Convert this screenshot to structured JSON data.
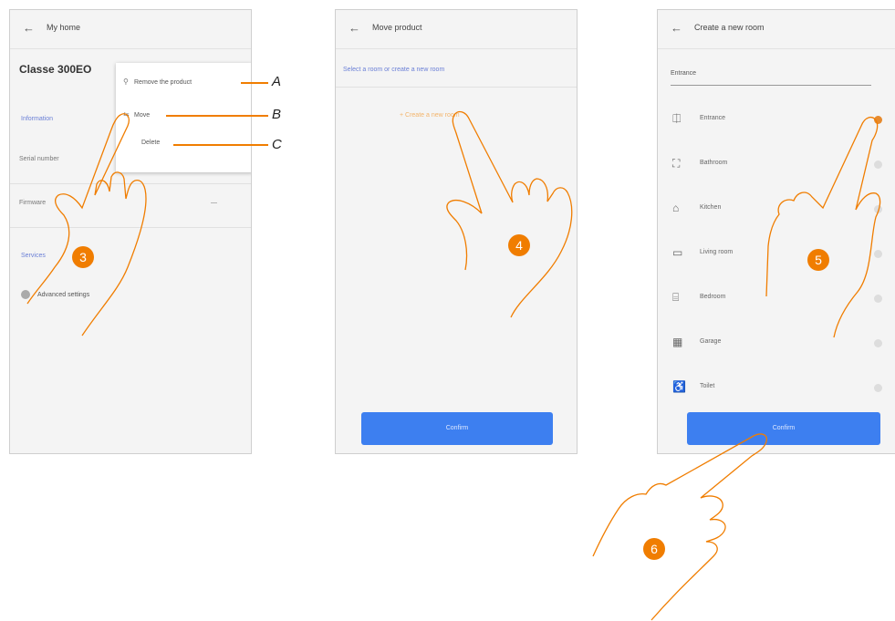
{
  "panel1": {
    "title": "My home",
    "device_title": "Classe 300EO",
    "menu": {
      "remove": "Remove the product",
      "move": "Move",
      "delete": "Delete"
    },
    "blue_label": "Information",
    "serial_label": "Serial number",
    "firmware_label": "Firmware",
    "firmware_value": "—",
    "section_link": "Services",
    "advanced": "Advanced settings"
  },
  "panel2": {
    "title": "Move product",
    "blue_info": "Select a room or create a new room",
    "orange_option": "+ Create a new room",
    "confirm": "Confirm"
  },
  "panel3": {
    "title": "Create a new room",
    "input_value": "Entrance",
    "rooms": [
      {
        "icon": "entrance-icon",
        "glyph": "⎅",
        "label": "Entrance",
        "selected": true
      },
      {
        "icon": "bathroom-icon",
        "glyph": "⛶",
        "label": "Bathroom",
        "selected": false
      },
      {
        "icon": "kitchen-icon",
        "glyph": "⌂",
        "label": "Kitchen",
        "selected": false
      },
      {
        "icon": "living-room-icon",
        "glyph": "▭",
        "label": "Living room",
        "selected": false
      },
      {
        "icon": "bedroom-icon",
        "glyph": "⌸",
        "label": "Bedroom",
        "selected": false
      },
      {
        "icon": "garage-icon",
        "glyph": "▦",
        "label": "Garage",
        "selected": false
      },
      {
        "icon": "toilet-icon",
        "glyph": "♿",
        "label": "Toilet",
        "selected": false
      }
    ],
    "confirm": "Confirm"
  },
  "callouts": {
    "a": "A",
    "b": "B",
    "c": "C"
  },
  "steps": {
    "s3": "3",
    "s4": "4",
    "s5": "5",
    "s6": "6"
  },
  "colors": {
    "accent_orange": "#f07d00",
    "button_blue": "#3d7ff0"
  }
}
